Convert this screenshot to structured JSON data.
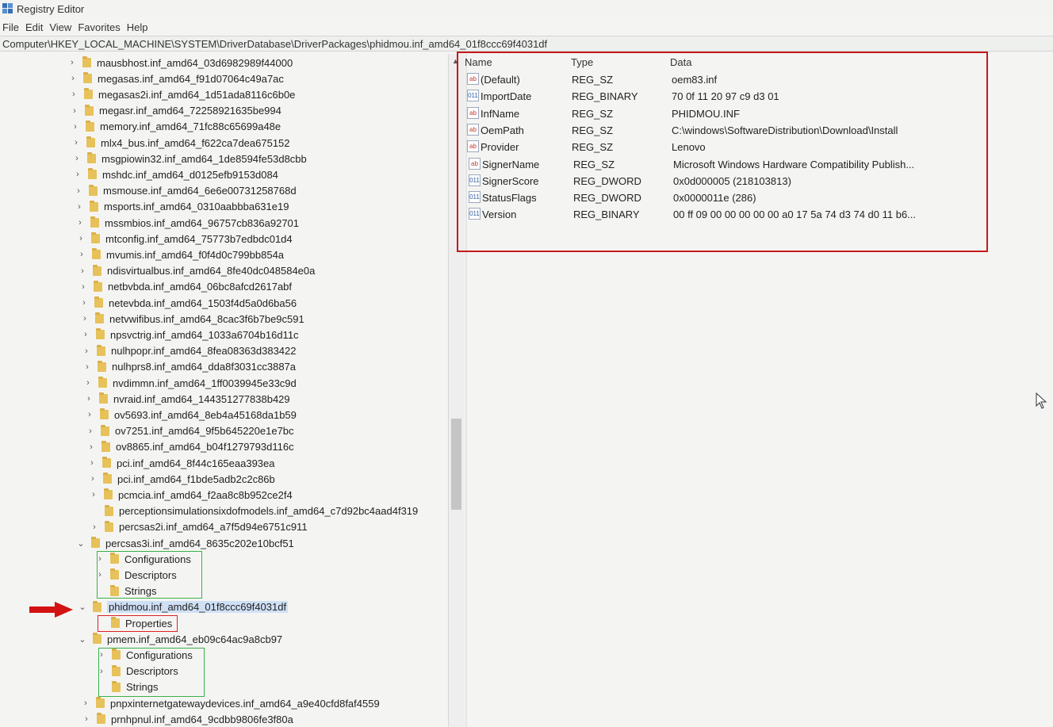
{
  "window": {
    "title": "Registry Editor"
  },
  "menu": [
    "File",
    "Edit",
    "View",
    "Favorites",
    "Help"
  ],
  "address": "Computer\\HKEY_LOCAL_MACHINE\\SYSTEM\\DriverDatabase\\DriverPackages\\phidmou.inf_amd64_01f8ccc69f4031df",
  "tree": {
    "items": [
      {
        "label": "mausbhost.inf_amd64_03d6982989f44000",
        "expander": "closed"
      },
      {
        "label": "megasas.inf_amd64_f91d07064c49a7ac",
        "expander": "closed"
      },
      {
        "label": "megasas2i.inf_amd64_1d51ada8116c6b0e",
        "expander": "closed"
      },
      {
        "label": "megasr.inf_amd64_72258921635be994",
        "expander": "closed"
      },
      {
        "label": "memory.inf_amd64_71fc88c65699a48e",
        "expander": "closed"
      },
      {
        "label": "mlx4_bus.inf_amd64_f622ca7dea675152",
        "expander": "closed"
      },
      {
        "label": "msgpiowin32.inf_amd64_1de8594fe53d8cbb",
        "expander": "closed"
      },
      {
        "label": "mshdc.inf_amd64_d0125efb9153d084",
        "expander": "closed"
      },
      {
        "label": "msmouse.inf_amd64_6e6e00731258768d",
        "expander": "closed"
      },
      {
        "label": "msports.inf_amd64_0310aabbba631e19",
        "expander": "closed"
      },
      {
        "label": "mssmbios.inf_amd64_96757cb836a92701",
        "expander": "closed"
      },
      {
        "label": "mtconfig.inf_amd64_75773b7edbdc01d4",
        "expander": "closed"
      },
      {
        "label": "mvumis.inf_amd64_f0f4d0c799bb854a",
        "expander": "closed"
      },
      {
        "label": "ndisvirtualbus.inf_amd64_8fe40dc048584e0a",
        "expander": "closed"
      },
      {
        "label": "netbvbda.inf_amd64_06bc8afcd2617abf",
        "expander": "closed"
      },
      {
        "label": "netevbda.inf_amd64_1503f4d5a0d6ba56",
        "expander": "closed"
      },
      {
        "label": "netvwifibus.inf_amd64_8cac3f6b7be9c591",
        "expander": "closed"
      },
      {
        "label": "npsvctrig.inf_amd64_1033a6704b16d11c",
        "expander": "closed"
      },
      {
        "label": "nulhpopr.inf_amd64_8fea08363d383422",
        "expander": "closed"
      },
      {
        "label": "nulhprs8.inf_amd64_dda8f3031cc3887a",
        "expander": "closed"
      },
      {
        "label": "nvdimmn.inf_amd64_1ff0039945e33c9d",
        "expander": "closed"
      },
      {
        "label": "nvraid.inf_amd64_144351277838b429",
        "expander": "closed"
      },
      {
        "label": "ov5693.inf_amd64_8eb4a45168da1b59",
        "expander": "closed"
      },
      {
        "label": "ov7251.inf_amd64_9f5b645220e1e7bc",
        "expander": "closed"
      },
      {
        "label": "ov8865.inf_amd64_b04f1279793d116c",
        "expander": "closed"
      },
      {
        "label": "pci.inf_amd64_8f44c165eaa393ea",
        "expander": "closed"
      },
      {
        "label": "pci.inf_amd64_f1bde5adb2c2c86b",
        "expander": "closed"
      },
      {
        "label": "pcmcia.inf_amd64_f2aa8c8b952ce2f4",
        "expander": "closed"
      },
      {
        "label": "perceptionsimulationsixdofmodels.inf_amd64_c7d92bc4aad4f319",
        "expander": "none"
      },
      {
        "label": "percsas2i.inf_amd64_a7f5d94e6751c911",
        "expander": "closed"
      },
      {
        "label": "percsas3i.inf_amd64_8635c202e10bcf51",
        "expander": "open"
      },
      {
        "label": "Configurations",
        "expander": "closed"
      },
      {
        "label": "Descriptors",
        "expander": "closed"
      },
      {
        "label": "Strings",
        "expander": "none"
      },
      {
        "label": "phidmou.inf_amd64_01f8ccc69f4031df",
        "expander": "open"
      },
      {
        "label": "Properties",
        "expander": "none"
      },
      {
        "label": "pmem.inf_amd64_eb09c64ac9a8cb97",
        "expander": "open"
      },
      {
        "label": "Configurations",
        "expander": "closed"
      },
      {
        "label": "Descriptors",
        "expander": "closed"
      },
      {
        "label": "Strings",
        "expander": "none"
      },
      {
        "label": "pnpxinternetgatewaydevices.inf_amd64_a9e40cfd8faf4559",
        "expander": "closed"
      },
      {
        "label": "prnhpnul.inf_amd64_9cdbb9806fe3f80a",
        "expander": "closed"
      }
    ]
  },
  "values": {
    "headers": {
      "name": "Name",
      "type": "Type",
      "data": "Data"
    },
    "rows": [
      {
        "name": "(Default)",
        "type": "REG_SZ",
        "data": "oem83.inf",
        "icon": "string-value-icon"
      },
      {
        "name": "ImportDate",
        "type": "REG_BINARY",
        "data": "70 0f 11 20 97 c9 d3 01",
        "icon": "binary-value-icon"
      },
      {
        "name": "InfName",
        "type": "REG_SZ",
        "data": "PHIDMOU.INF",
        "icon": "string-value-icon"
      },
      {
        "name": "OemPath",
        "type": "REG_SZ",
        "data": "C:\\windows\\SoftwareDistribution\\Download\\Install",
        "icon": "string-value-icon"
      },
      {
        "name": "Provider",
        "type": "REG_SZ",
        "data": "Lenovo",
        "icon": "string-value-icon"
      },
      {
        "name": "SignerName",
        "type": "REG_SZ",
        "data": "Microsoft Windows Hardware Compatibility Publish...",
        "icon": "string-value-icon"
      },
      {
        "name": "SignerScore",
        "type": "REG_DWORD",
        "data": "0x0d000005 (218103813)",
        "icon": "binary-value-icon"
      },
      {
        "name": "StatusFlags",
        "type": "REG_DWORD",
        "data": "0x0000011e (286)",
        "icon": "binary-value-icon"
      },
      {
        "name": "Version",
        "type": "REG_BINARY",
        "data": "00 ff 09 00 00 00 00 00 a0 17 5a 74 d3 74 d0 11 b6...",
        "icon": "binary-value-icon"
      }
    ]
  },
  "colors": {
    "annotation_red": "#c41a1a",
    "annotation_green": "#39b04a",
    "selection": "#cfe0f5"
  }
}
